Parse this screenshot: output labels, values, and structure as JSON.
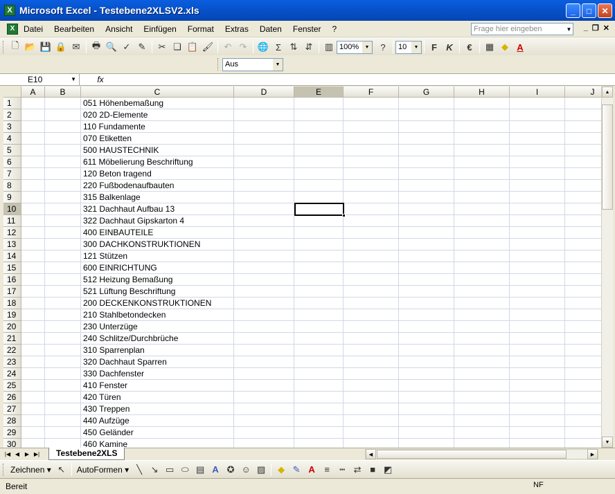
{
  "window": {
    "title": "Microsoft Excel - Testebene2XLSV2.xls",
    "minimize": "_",
    "maximize": "□",
    "close": "✕",
    "app_icon": "X"
  },
  "menu": {
    "items": [
      "Datei",
      "Bearbeiten",
      "Ansicht",
      "Einfügen",
      "Format",
      "Extras",
      "Daten",
      "Fenster",
      "?"
    ],
    "ask_placeholder": "Frage hier eingeben",
    "doc_icon": "X"
  },
  "toolbar": {
    "zoom": "100%",
    "font_size": "10",
    "style_combo": "Aus",
    "sum": "Σ",
    "euro": "€",
    "bold": "F",
    "italic": "K"
  },
  "formula": {
    "name_box": "E10",
    "fx": "fx",
    "content": ""
  },
  "grid": {
    "columns": [
      "A",
      "B",
      "C",
      "D",
      "E",
      "F",
      "G",
      "H",
      "I",
      "J"
    ],
    "active_column": "E",
    "active_row": 10,
    "rows": [
      {
        "n": "1",
        "c": "051 Höhenbemaßung"
      },
      {
        "n": "2",
        "c": "020 2D-Elemente"
      },
      {
        "n": "3",
        "c": "110 Fundamente"
      },
      {
        "n": "4",
        "c": "070 Etiketten"
      },
      {
        "n": "5",
        "c": "500 HAUSTECHNIK"
      },
      {
        "n": "6",
        "c": "611 Möbelierung Beschriftung"
      },
      {
        "n": "7",
        "c": "120 Beton tragend"
      },
      {
        "n": "8",
        "c": "220 Fußbodenaufbauten"
      },
      {
        "n": "9",
        "c": "315 Balkenlage"
      },
      {
        "n": "10",
        "c": "321 Dachhaut Aufbau 13"
      },
      {
        "n": "11",
        "c": "322 Dachhaut Gipskarton 4"
      },
      {
        "n": "12",
        "c": "400 EINBAUTEILE"
      },
      {
        "n": "13",
        "c": "300 DACHKONSTRUKTIONEN"
      },
      {
        "n": "14",
        "c": "121 Stützen"
      },
      {
        "n": "15",
        "c": "600 EINRICHTUNG"
      },
      {
        "n": "16",
        "c": "512 Heizung Bemaßung"
      },
      {
        "n": "17",
        "c": "521 Lüftung Beschriftung"
      },
      {
        "n": "18",
        "c": "200 DECKENKONSTRUKTIONEN"
      },
      {
        "n": "19",
        "c": "210 Stahlbetondecken"
      },
      {
        "n": "20",
        "c": "230 Unterzüge"
      },
      {
        "n": "21",
        "c": "240 Schlitze/Durchbrüche"
      },
      {
        "n": "22",
        "c": "310 Sparrenplan"
      },
      {
        "n": "23",
        "c": "320 Dachhaut Sparren"
      },
      {
        "n": "24",
        "c": "330 Dachfenster"
      },
      {
        "n": "25",
        "c": "410 Fenster"
      },
      {
        "n": "26",
        "c": "420 Türen"
      },
      {
        "n": "27",
        "c": "430 Treppen"
      },
      {
        "n": "28",
        "c": "440 Aufzüge"
      },
      {
        "n": "29",
        "c": "450 Geländer"
      },
      {
        "n": "30",
        "c": "460 Kamine"
      }
    ]
  },
  "sheet_tabs": [
    "Testebene2XLS"
  ],
  "drawing": {
    "zeichnen": "Zeichnen",
    "autoformen": "AutoFormen"
  },
  "status": {
    "text": "Bereit",
    "nf": "NF"
  }
}
